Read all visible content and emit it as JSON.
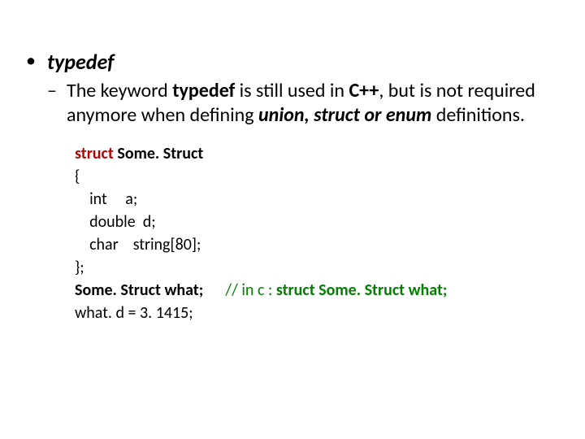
{
  "bullet": {
    "marker": "•",
    "title": "typedef"
  },
  "sub": {
    "dash": "–",
    "pre": "The keyword ",
    "kw": "typedef",
    "mid1": " is still used in ",
    "lang": "C++",
    "mid2": ", but is not required anymore when defining ",
    "kws": "union, struct or enum",
    "post": " definitions."
  },
  "code": {
    "l1_kw": "struct",
    "l1_rest": " Some. Struct",
    "l2": "{",
    "l3": "    int     a;",
    "l4": "    double  d;",
    "l5": "    char    string[80];",
    "l6": "};",
    "l7_a": "Some. Struct what;      ",
    "l7_comment": "// in c : struct Some. Struct what;",
    "l8": "what. d = 3. 1415;"
  }
}
